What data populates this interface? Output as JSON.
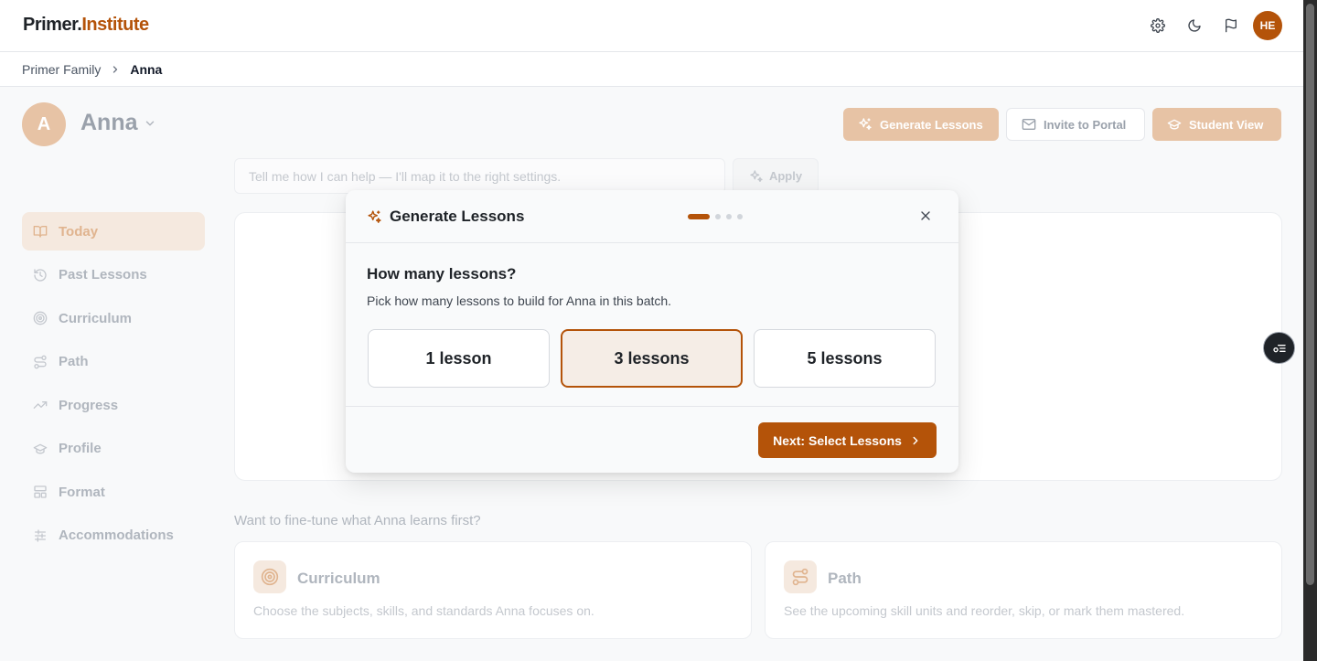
{
  "app": {
    "logo_part1": "Primer.",
    "logo_part2": "Institute",
    "user_initials": "HE",
    "accent_color": "#b45309"
  },
  "breadcrumb": {
    "items": [
      "Primer Family",
      "Anna"
    ]
  },
  "student": {
    "initial": "A",
    "name": "Anna"
  },
  "header_actions": {
    "generate_label": "Generate Lessons",
    "invite_label": "Invite to Portal",
    "student_view_label": "Student View"
  },
  "prompt": {
    "placeholder": "Tell me how I can help — I'll map it to the right settings.",
    "apply_label": "Apply"
  },
  "sidebar": {
    "items": [
      {
        "label": "Today",
        "icon": "book-open-icon",
        "active": true
      },
      {
        "label": "Past Lessons",
        "icon": "history-icon"
      },
      {
        "label": "Curriculum",
        "icon": "target-icon"
      },
      {
        "label": "Path",
        "icon": "route-icon"
      },
      {
        "label": "Progress",
        "icon": "trending-up-icon"
      },
      {
        "label": "Profile",
        "icon": "graduation-cap-icon"
      },
      {
        "label": "Format",
        "icon": "layout-icon"
      },
      {
        "label": "Accommodations",
        "icon": "sliders-icon"
      }
    ]
  },
  "fine_tune": {
    "prompt": "Want to fine-tune what Anna learns first?",
    "tiles": [
      {
        "title": "Curriculum",
        "desc": "Choose the subjects, skills, and standards Anna focuses on.",
        "icon": "target-icon"
      },
      {
        "title": "Path",
        "desc": "See the upcoming skill units and reorder, skip, or mark them mastered.",
        "icon": "route-icon"
      }
    ]
  },
  "modal": {
    "title": "Generate Lessons",
    "step_current": 1,
    "step_total": 4,
    "question": "How many lessons?",
    "subtitle": "Pick how many lessons to build for Anna in this batch.",
    "options": [
      "1 lesson",
      "3 lessons",
      "5 lessons"
    ],
    "selected_option": "3 lessons",
    "next_label": "Next: Select Lessons"
  }
}
